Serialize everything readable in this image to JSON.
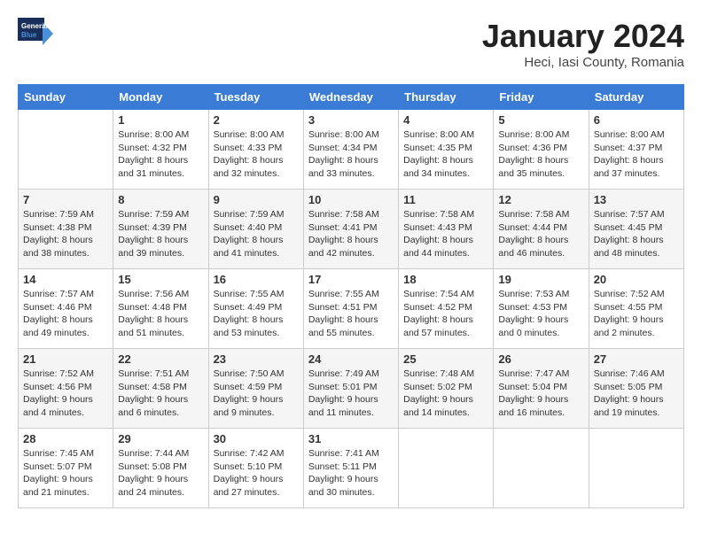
{
  "header": {
    "logo_general": "General",
    "logo_blue": "Blue",
    "month_title": "January 2024",
    "location": "Heci, Iasi County, Romania"
  },
  "days_of_week": [
    "Sunday",
    "Monday",
    "Tuesday",
    "Wednesday",
    "Thursday",
    "Friday",
    "Saturday"
  ],
  "weeks": [
    [
      {
        "day": "",
        "info": ""
      },
      {
        "day": "1",
        "info": "Sunrise: 8:00 AM\nSunset: 4:32 PM\nDaylight: 8 hours\nand 31 minutes."
      },
      {
        "day": "2",
        "info": "Sunrise: 8:00 AM\nSunset: 4:33 PM\nDaylight: 8 hours\nand 32 minutes."
      },
      {
        "day": "3",
        "info": "Sunrise: 8:00 AM\nSunset: 4:34 PM\nDaylight: 8 hours\nand 33 minutes."
      },
      {
        "day": "4",
        "info": "Sunrise: 8:00 AM\nSunset: 4:35 PM\nDaylight: 8 hours\nand 34 minutes."
      },
      {
        "day": "5",
        "info": "Sunrise: 8:00 AM\nSunset: 4:36 PM\nDaylight: 8 hours\nand 35 minutes."
      },
      {
        "day": "6",
        "info": "Sunrise: 8:00 AM\nSunset: 4:37 PM\nDaylight: 8 hours\nand 37 minutes."
      }
    ],
    [
      {
        "day": "7",
        "info": "Sunrise: 7:59 AM\nSunset: 4:38 PM\nDaylight: 8 hours\nand 38 minutes."
      },
      {
        "day": "8",
        "info": "Sunrise: 7:59 AM\nSunset: 4:39 PM\nDaylight: 8 hours\nand 39 minutes."
      },
      {
        "day": "9",
        "info": "Sunrise: 7:59 AM\nSunset: 4:40 PM\nDaylight: 8 hours\nand 41 minutes."
      },
      {
        "day": "10",
        "info": "Sunrise: 7:58 AM\nSunset: 4:41 PM\nDaylight: 8 hours\nand 42 minutes."
      },
      {
        "day": "11",
        "info": "Sunrise: 7:58 AM\nSunset: 4:43 PM\nDaylight: 8 hours\nand 44 minutes."
      },
      {
        "day": "12",
        "info": "Sunrise: 7:58 AM\nSunset: 4:44 PM\nDaylight: 8 hours\nand 46 minutes."
      },
      {
        "day": "13",
        "info": "Sunrise: 7:57 AM\nSunset: 4:45 PM\nDaylight: 8 hours\nand 48 minutes."
      }
    ],
    [
      {
        "day": "14",
        "info": "Sunrise: 7:57 AM\nSunset: 4:46 PM\nDaylight: 8 hours\nand 49 minutes."
      },
      {
        "day": "15",
        "info": "Sunrise: 7:56 AM\nSunset: 4:48 PM\nDaylight: 8 hours\nand 51 minutes."
      },
      {
        "day": "16",
        "info": "Sunrise: 7:55 AM\nSunset: 4:49 PM\nDaylight: 8 hours\nand 53 minutes."
      },
      {
        "day": "17",
        "info": "Sunrise: 7:55 AM\nSunset: 4:51 PM\nDaylight: 8 hours\nand 55 minutes."
      },
      {
        "day": "18",
        "info": "Sunrise: 7:54 AM\nSunset: 4:52 PM\nDaylight: 8 hours\nand 57 minutes."
      },
      {
        "day": "19",
        "info": "Sunrise: 7:53 AM\nSunset: 4:53 PM\nDaylight: 9 hours\nand 0 minutes."
      },
      {
        "day": "20",
        "info": "Sunrise: 7:52 AM\nSunset: 4:55 PM\nDaylight: 9 hours\nand 2 minutes."
      }
    ],
    [
      {
        "day": "21",
        "info": "Sunrise: 7:52 AM\nSunset: 4:56 PM\nDaylight: 9 hours\nand 4 minutes."
      },
      {
        "day": "22",
        "info": "Sunrise: 7:51 AM\nSunset: 4:58 PM\nDaylight: 9 hours\nand 6 minutes."
      },
      {
        "day": "23",
        "info": "Sunrise: 7:50 AM\nSunset: 4:59 PM\nDaylight: 9 hours\nand 9 minutes."
      },
      {
        "day": "24",
        "info": "Sunrise: 7:49 AM\nSunset: 5:01 PM\nDaylight: 9 hours\nand 11 minutes."
      },
      {
        "day": "25",
        "info": "Sunrise: 7:48 AM\nSunset: 5:02 PM\nDaylight: 9 hours\nand 14 minutes."
      },
      {
        "day": "26",
        "info": "Sunrise: 7:47 AM\nSunset: 5:04 PM\nDaylight: 9 hours\nand 16 minutes."
      },
      {
        "day": "27",
        "info": "Sunrise: 7:46 AM\nSunset: 5:05 PM\nDaylight: 9 hours\nand 19 minutes."
      }
    ],
    [
      {
        "day": "28",
        "info": "Sunrise: 7:45 AM\nSunset: 5:07 PM\nDaylight: 9 hours\nand 21 minutes."
      },
      {
        "day": "29",
        "info": "Sunrise: 7:44 AM\nSunset: 5:08 PM\nDaylight: 9 hours\nand 24 minutes."
      },
      {
        "day": "30",
        "info": "Sunrise: 7:42 AM\nSunset: 5:10 PM\nDaylight: 9 hours\nand 27 minutes."
      },
      {
        "day": "31",
        "info": "Sunrise: 7:41 AM\nSunset: 5:11 PM\nDaylight: 9 hours\nand 30 minutes."
      },
      {
        "day": "",
        "info": ""
      },
      {
        "day": "",
        "info": ""
      },
      {
        "day": "",
        "info": ""
      }
    ]
  ]
}
